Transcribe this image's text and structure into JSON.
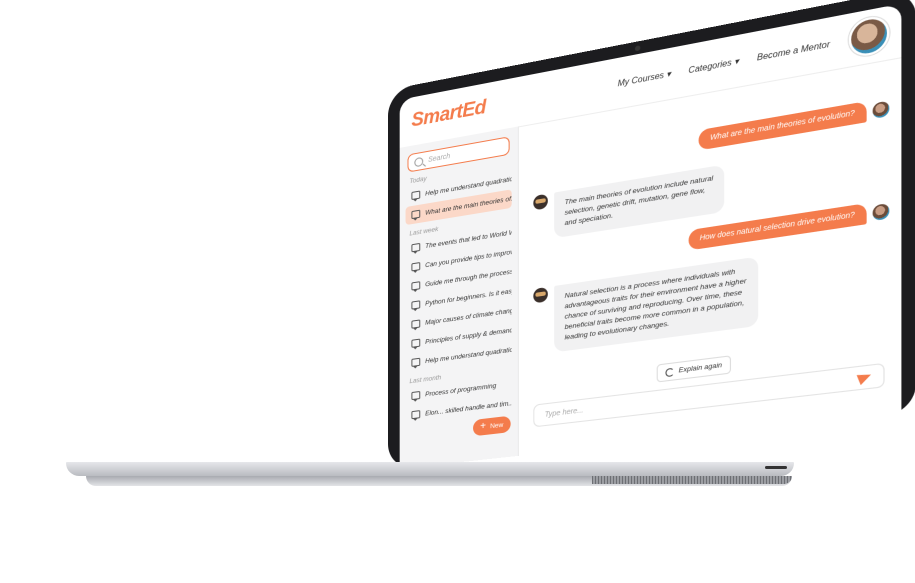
{
  "app": {
    "brand": "SmartEd",
    "accent": "#f47c4c"
  },
  "nav": {
    "my_courses": "My Courses ▾",
    "categories": "Categories ▾",
    "become_mentor": "Become a Mentor"
  },
  "sidebar": {
    "search_placeholder": "Search",
    "sections": {
      "today": "Today",
      "last_week": "Last week",
      "last_month": "Last month"
    },
    "today_items": [
      "Help me understand quadratic...",
      "What are the main theories of..."
    ],
    "last_week_items": [
      "The events that led to World W...",
      "Can you provide tips to improv...",
      "Guide me through the process...",
      "Python for beginners. Is it easy...",
      "Major causes of climate chang...",
      "Principles of supply & demand...",
      "Help me understand quadratic..."
    ],
    "last_month_items": [
      "Process of programming",
      "Elon... skilled handle and tim..."
    ],
    "new_button": "New"
  },
  "chat": {
    "messages": [
      {
        "role": "user",
        "text": "What are the main theories of evolution?"
      },
      {
        "role": "bot",
        "lines": [
          "The main theories of evolution include natural",
          "selection, genetic drift, mutation, gene flow,",
          "and speciation."
        ]
      },
      {
        "role": "user",
        "text": "How does natural selection drive evolution?"
      },
      {
        "role": "bot",
        "lines": [
          "Natural selection is a process where individuals with",
          "advantageous traits for their environment have a higher",
          "chance of surviving and reproducing. Over time, these",
          "beneficial traits become more common in a population,",
          "leading to evolutionary changes."
        ]
      }
    ],
    "explain_again": "Explain again",
    "input_placeholder": "Type here..."
  }
}
